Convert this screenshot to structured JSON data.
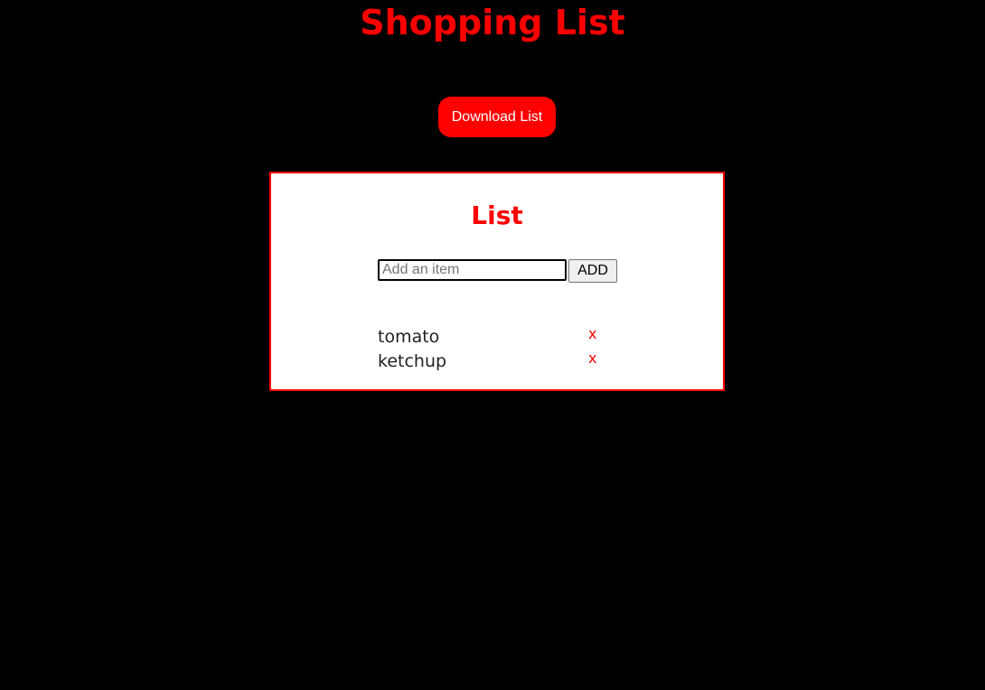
{
  "header": {
    "title": "Shopping List",
    "download_label": "Download List"
  },
  "card": {
    "title": "List",
    "input": {
      "placeholder": "Add an item",
      "value": ""
    },
    "add_label": "ADD",
    "items": [
      {
        "name": "tomato",
        "remove_label": "x"
      },
      {
        "name": "ketchup",
        "remove_label": "x"
      }
    ]
  },
  "colors": {
    "background": "#000000",
    "accent": "#ff0000",
    "card_background": "#ffffff"
  }
}
